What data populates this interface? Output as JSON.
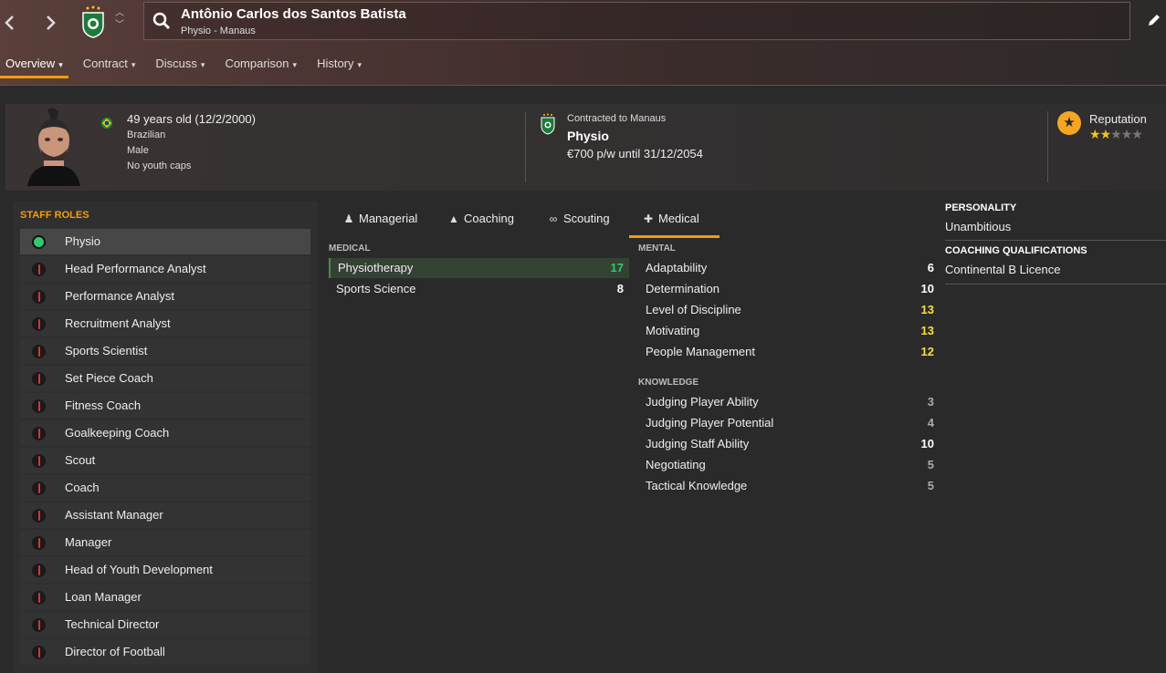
{
  "header": {
    "name": "Antônio Carlos dos Santos Batista",
    "subtitle": "Physio - Manaus",
    "back_icon": "chevron-left-icon",
    "forward_icon": "chevron-right-icon"
  },
  "tabs": [
    {
      "label": "Overview"
    },
    {
      "label": "Contract"
    },
    {
      "label": "Discuss"
    },
    {
      "label": "Comparison"
    },
    {
      "label": "History"
    }
  ],
  "profile": {
    "age_line": "49 years old (12/2/2000)",
    "nationality": "Brazilian",
    "gender": "Male",
    "youth_caps": "No youth caps",
    "contract_label": "Contracted to Manaus",
    "role": "Physio",
    "wage": "€700 p/w until 31/12/2054",
    "reputation_label": "Reputation",
    "reputation_stars": 2,
    "reputation_max": 5
  },
  "staff_roles": {
    "title": "STAFF ROLES",
    "items": [
      {
        "label": "Physio",
        "active": true
      },
      {
        "label": "Head Performance Analyst"
      },
      {
        "label": "Performance Analyst"
      },
      {
        "label": "Recruitment Analyst"
      },
      {
        "label": "Sports Scientist"
      },
      {
        "label": "Set Piece Coach"
      },
      {
        "label": "Fitness Coach"
      },
      {
        "label": "Goalkeeping Coach"
      },
      {
        "label": "Scout"
      },
      {
        "label": "Coach"
      },
      {
        "label": "Assistant Manager"
      },
      {
        "label": "Manager"
      },
      {
        "label": "Head of Youth Development"
      },
      {
        "label": "Loan Manager"
      },
      {
        "label": "Technical Director"
      },
      {
        "label": "Director of Football"
      }
    ]
  },
  "attr_tabs": [
    {
      "label": "Managerial",
      "icon": "person-icon"
    },
    {
      "label": "Coaching",
      "icon": "cone-icon"
    },
    {
      "label": "Scouting",
      "icon": "binoculars-icon"
    },
    {
      "label": "Medical",
      "icon": "medkit-icon",
      "active": true
    }
  ],
  "medical": {
    "title": "MEDICAL",
    "attrs": [
      {
        "name": "Physiotherapy",
        "value": "17"
      },
      {
        "name": "Sports Science",
        "value": "8"
      }
    ]
  },
  "mental": {
    "title": "MENTAL",
    "attrs": [
      {
        "name": "Adaptability",
        "value": "6"
      },
      {
        "name": "Determination",
        "value": "10"
      },
      {
        "name": "Level of Discipline",
        "value": "13"
      },
      {
        "name": "Motivating",
        "value": "13"
      },
      {
        "name": "People Management",
        "value": "12"
      }
    ]
  },
  "knowledge": {
    "title": "KNOWLEDGE",
    "attrs": [
      {
        "name": "Judging Player Ability",
        "value": "3"
      },
      {
        "name": "Judging Player Potential",
        "value": "4"
      },
      {
        "name": "Judging Staff Ability",
        "value": "10"
      },
      {
        "name": "Negotiating",
        "value": "5"
      },
      {
        "name": "Tactical Knowledge",
        "value": "5"
      }
    ]
  },
  "side": {
    "personality_title": "PERSONALITY",
    "personality": "Unambitious",
    "qual_title": "COACHING QUALIFICATIONS",
    "qual": "Continental B Licence"
  },
  "colors": {
    "accent": "#f39c12",
    "value_high": "#2ecc71",
    "value_good": "#f5e042",
    "value_mid": "#ffffff",
    "value_low": "#aaaaaa"
  }
}
